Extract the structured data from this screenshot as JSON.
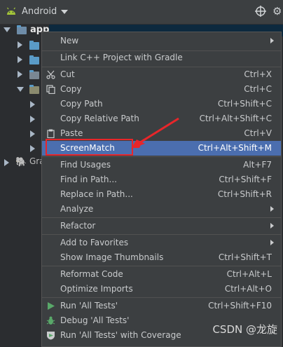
{
  "toolbar": {
    "project_view": "Android"
  },
  "tree": {
    "root_label": "app",
    "gradle_label": "Gra"
  },
  "menu": {
    "items": [
      {
        "label": "New",
        "shortcut": "",
        "submenu": true
      },
      {
        "label": "Link C++ Project with Gradle",
        "shortcut": ""
      },
      {
        "label": "Cut",
        "shortcut": "Ctrl+X",
        "icon": "scissors-icon"
      },
      {
        "label": "Copy",
        "shortcut": "Ctrl+C",
        "icon": "copy-icon"
      },
      {
        "label": "Copy Path",
        "shortcut": "Ctrl+Shift+C"
      },
      {
        "label": "Copy Relative Path",
        "shortcut": "Ctrl+Alt+Shift+C"
      },
      {
        "label": "Paste",
        "shortcut": "Ctrl+V",
        "icon": "paste-icon"
      },
      {
        "label": "ScreenMatch",
        "shortcut": "Ctrl+Alt+Shift+M",
        "highlighted": true
      },
      {
        "label": "Find Usages",
        "shortcut": "Alt+F7"
      },
      {
        "label": "Find in Path...",
        "shortcut": "Ctrl+Shift+F"
      },
      {
        "label": "Replace in Path...",
        "shortcut": "Ctrl+Shift+R"
      },
      {
        "label": "Analyze",
        "shortcut": "",
        "submenu": true
      },
      {
        "label": "Refactor",
        "shortcut": "",
        "submenu": true
      },
      {
        "label": "Add to Favorites",
        "shortcut": "",
        "submenu": true
      },
      {
        "label": "Show Image Thumbnails",
        "shortcut": "Ctrl+Shift+T"
      },
      {
        "label": "Reformat Code",
        "shortcut": "Ctrl+Alt+L"
      },
      {
        "label": "Optimize Imports",
        "shortcut": "Ctrl+Alt+O"
      },
      {
        "label": "Run 'All Tests'",
        "shortcut": "Ctrl+Shift+F10",
        "icon": "run-icon"
      },
      {
        "label": "Debug 'All Tests'",
        "shortcut": "",
        "icon": "debug-icon"
      },
      {
        "label": "Run 'All Tests' with Coverage",
        "shortcut": "",
        "icon": "coverage-icon"
      }
    ]
  },
  "watermark": "CSDN @龙旋",
  "colors": {
    "highlight": "#4b6eaf",
    "annotation_red": "#e8262a"
  }
}
